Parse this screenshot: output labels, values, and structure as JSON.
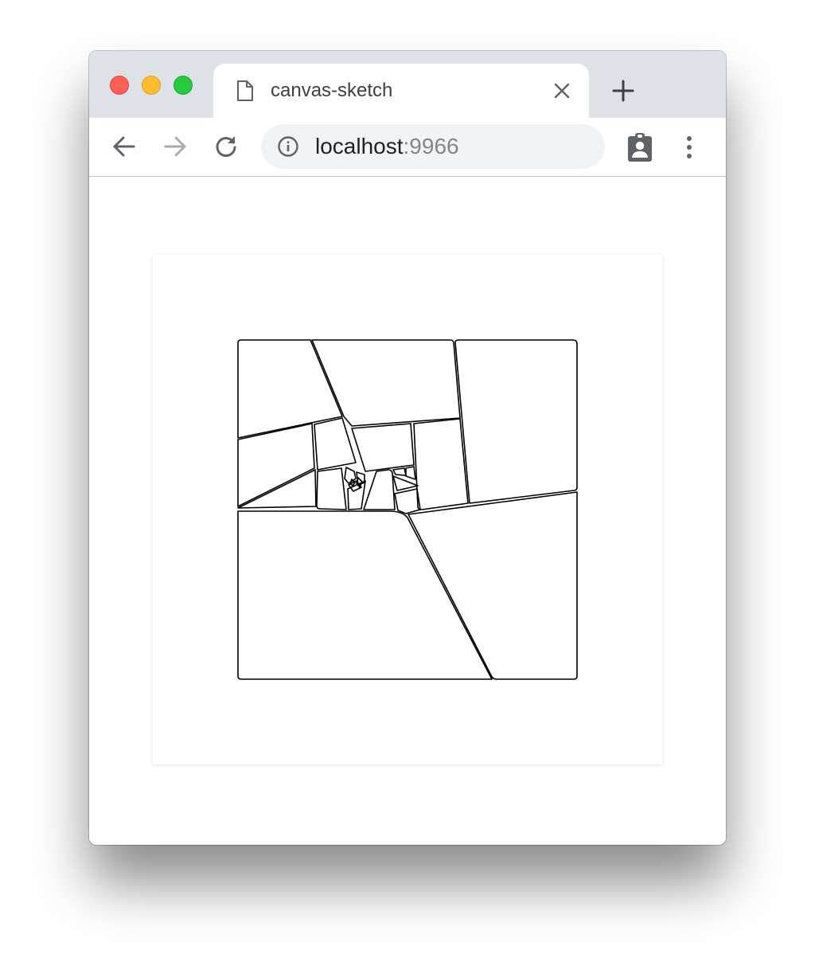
{
  "window": {
    "controls": [
      "close",
      "minimize",
      "maximize"
    ]
  },
  "tab": {
    "title": "canvas-sketch",
    "icon": "document-icon",
    "close_icon": "close-icon"
  },
  "new_tab_icon": "plus-icon",
  "toolbar": {
    "back_icon": "arrow-left-icon",
    "forward_icon": "arrow-right-icon",
    "reload_icon": "reload-icon",
    "info_icon": "info-icon",
    "profile_icon": "clipboard-account-icon",
    "menu_icon": "more-vert-icon"
  },
  "address": {
    "host": "localhost",
    "port": ":9966"
  },
  "colors": {
    "tabstrip": "#dee1e6",
    "close": "#fe5f57",
    "minimize": "#febc2e",
    "maximize": "#28c840",
    "omnibox": "#f1f3f4",
    "ink": "#000000"
  }
}
